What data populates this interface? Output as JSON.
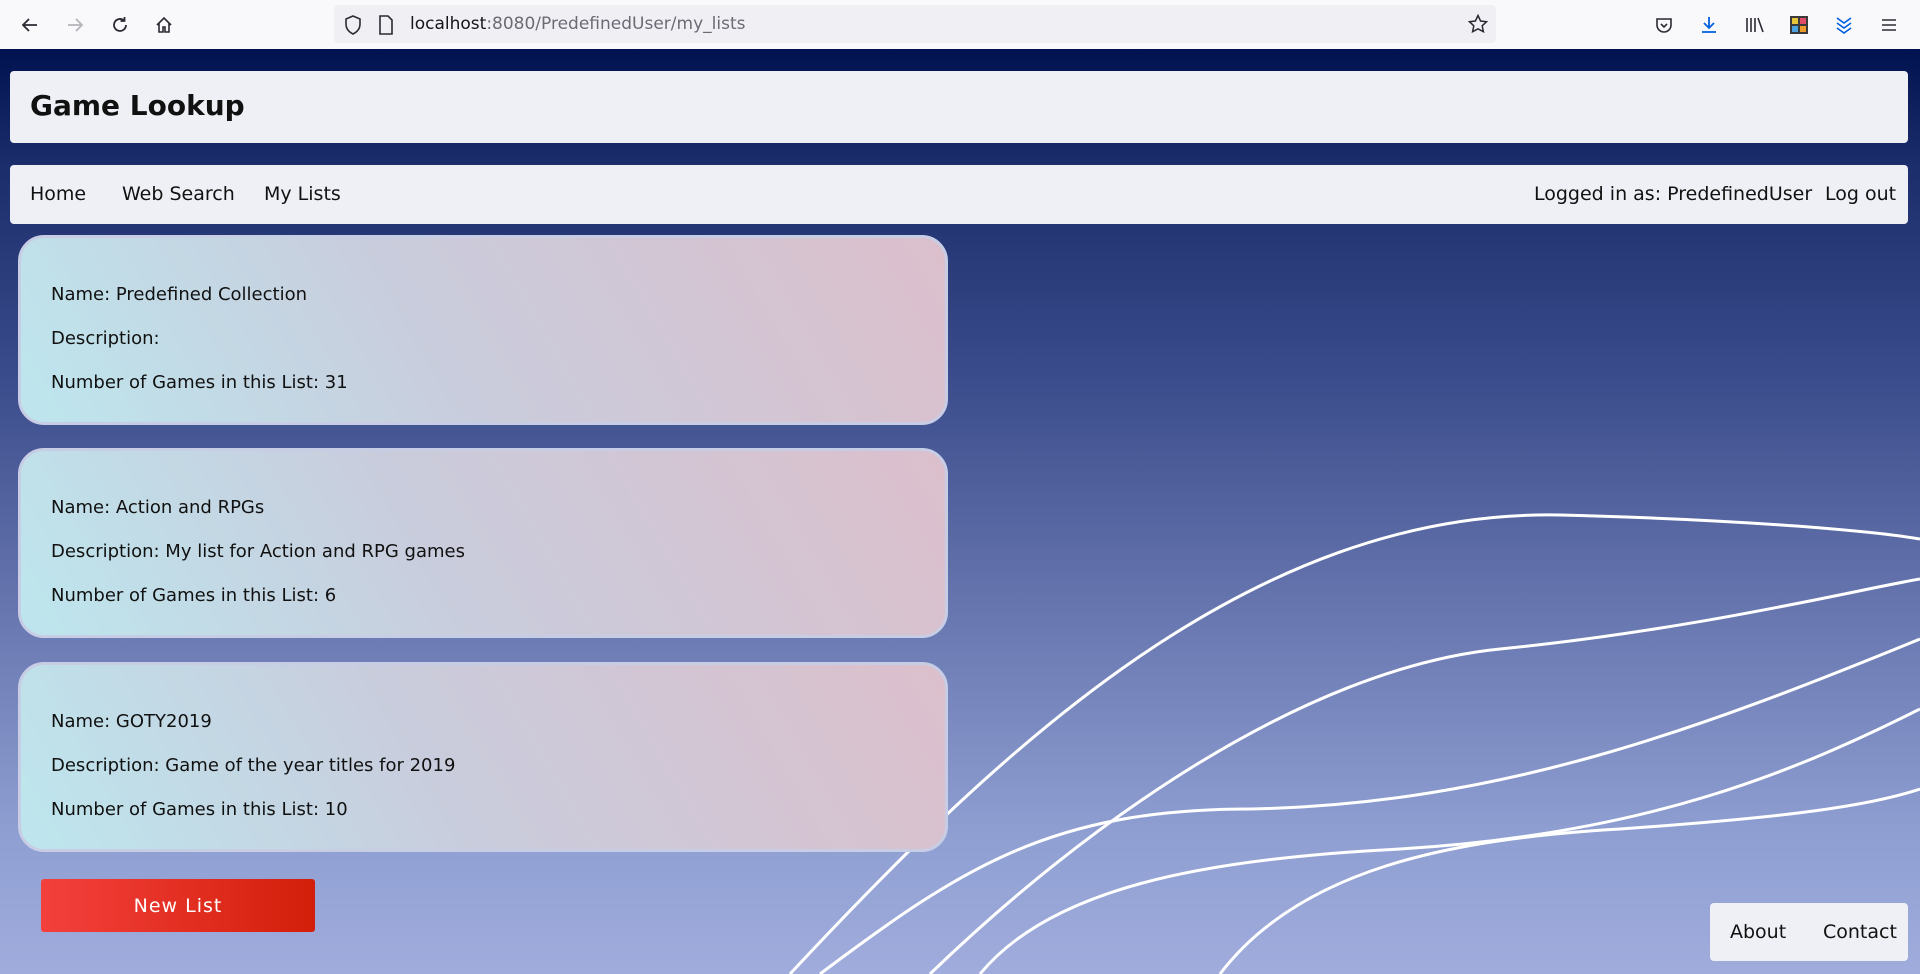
{
  "browser": {
    "url_host": "localhost",
    "url_rest": ":8080/PredefinedUser/my_lists"
  },
  "site": {
    "title": "Game Lookup"
  },
  "nav": {
    "home": "Home",
    "web_search": "Web Search",
    "my_lists": "My Lists",
    "logged_in": "Logged in as: PredefinedUser",
    "logout": "Log out"
  },
  "lists": [
    {
      "name": "Name: Predefined Collection",
      "description": "Description:",
      "count": "Number of Games in this List: 31"
    },
    {
      "name": "Name: Action and RPGs",
      "description": "Description: My list for Action and RPG games",
      "count": "Number of Games in this List: 6"
    },
    {
      "name": "Name: GOTY2019",
      "description": "Description: Game of the year titles for 2019",
      "count": "Number of Games in this List: 10"
    }
  ],
  "new_list_button": "New List",
  "footer": {
    "about": "About",
    "contact": "Contact"
  }
}
